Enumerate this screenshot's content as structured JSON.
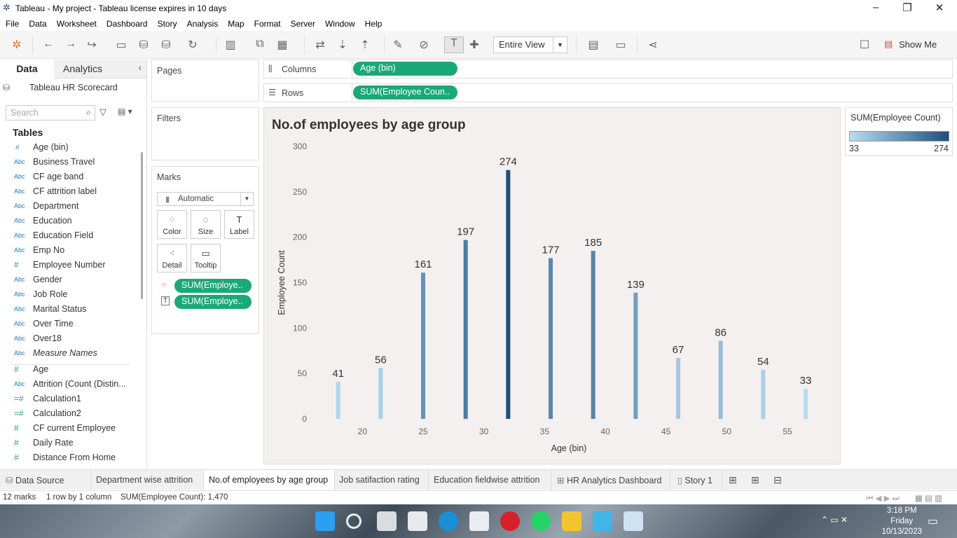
{
  "window": {
    "title": "Tableau - My project - Tableau license expires in 10 days"
  },
  "menu": [
    "File",
    "Data",
    "Worksheet",
    "Dashboard",
    "Story",
    "Analysis",
    "Map",
    "Format",
    "Server",
    "Window",
    "Help"
  ],
  "toolbar": {
    "view_select": "Entire View",
    "show_me": "Show Me"
  },
  "datapane": {
    "tab_data": "Data",
    "tab_analytics": "Analytics",
    "datasource": "Tableau HR Scorecard",
    "search_placeholder": "Search",
    "tables_header": "Tables",
    "fields": [
      {
        "icon": "bin",
        "label": "Age (bin)"
      },
      {
        "icon": "Abc",
        "label": "Business Travel"
      },
      {
        "icon": "Abc",
        "label": "CF age band"
      },
      {
        "icon": "Abc",
        "label": "CF attrition label"
      },
      {
        "icon": "Abc",
        "label": "Department"
      },
      {
        "icon": "Abc",
        "label": "Education"
      },
      {
        "icon": "Abc",
        "label": "Education Field"
      },
      {
        "icon": "Abc",
        "label": "Emp No"
      },
      {
        "icon": "#",
        "label": "Employee Number"
      },
      {
        "icon": "Abc",
        "label": "Gender"
      },
      {
        "icon": "Abc",
        "label": "Job Role"
      },
      {
        "icon": "Abc",
        "label": "Marital Status"
      },
      {
        "icon": "Abc",
        "label": "Over Time"
      },
      {
        "icon": "Abc",
        "label": "Over18"
      },
      {
        "icon": "Abc",
        "label": "Measure Names"
      },
      {
        "icon": "#",
        "label": "Age"
      },
      {
        "icon": "Abc",
        "label": "Attrition (Count (Distin..."
      },
      {
        "icon": "=#",
        "label": "Calculation1"
      },
      {
        "icon": "=#",
        "label": "Calculation2"
      },
      {
        "icon": "#",
        "label": "CF current Employee"
      },
      {
        "icon": "#",
        "label": "Daily Rate"
      },
      {
        "icon": "#",
        "label": "Distance From Home"
      }
    ]
  },
  "cards": {
    "pages": "Pages",
    "filters": "Filters",
    "marks": "Marks",
    "mark_type": "Automatic",
    "buttons": [
      "Color",
      "Size",
      "Label",
      "Detail",
      "Tooltip"
    ],
    "mark_pills": [
      "SUM(Employe..",
      "SUM(Employe.."
    ]
  },
  "shelves": {
    "columns_label": "Columns",
    "columns_pill": "Age (bin)",
    "rows_label": "Rows",
    "rows_pill": "SUM(Employee Coun.."
  },
  "legend": {
    "title": "SUM(Employee Count)",
    "min": "33",
    "max": "274"
  },
  "sheet_tabs": [
    "Data Source",
    "Department wise attrition",
    "No.of employees by age group",
    "Job satifaction rating",
    "Education fieldwise attrition",
    "HR Analytics Dashboard",
    "Story 1"
  ],
  "status": {
    "marks": "12 marks",
    "rows": "1 row by 1 column",
    "sum": "SUM(Employee Count): 1,470"
  },
  "clock": {
    "time": "3:18 PM",
    "day": "Friday",
    "date": "10/13/2023"
  },
  "colors": {
    "pill": "#1ba878",
    "light": "#b8dcf2",
    "dark": "#1e4f7d"
  },
  "chart_data": {
    "type": "bar",
    "title": "No.of employees by age group",
    "xlabel": "Age (bin)",
    "ylabel": "Employee Count",
    "x": [
      18,
      21.5,
      25,
      28.5,
      32,
      35.5,
      39,
      42.5,
      46,
      49.5,
      53,
      56.5
    ],
    "values": [
      41,
      56,
      161,
      197,
      274,
      177,
      185,
      139,
      67,
      86,
      54,
      33
    ],
    "xticks": [
      20,
      25,
      30,
      35,
      40,
      45,
      50,
      55
    ],
    "yticks": [
      0,
      50,
      100,
      150,
      200,
      250,
      300
    ],
    "ylim": [
      0,
      300
    ],
    "xlim": [
      16,
      58
    ],
    "color_range": [
      33,
      274
    ]
  }
}
